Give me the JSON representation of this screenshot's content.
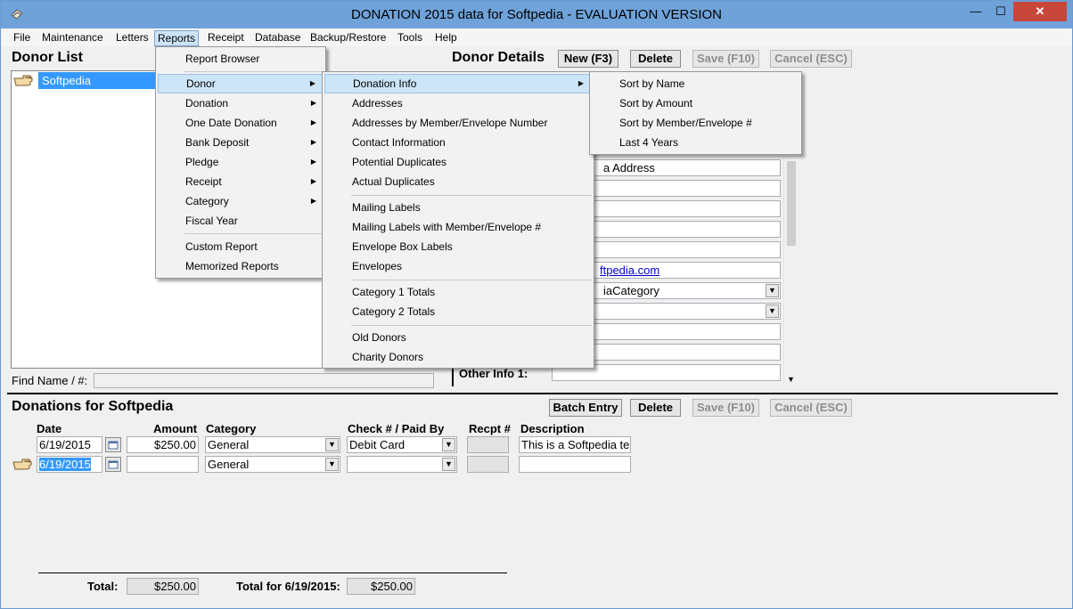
{
  "window": {
    "title": "DONATION 2015 data for Softpedia - EVALUATION VERSION",
    "min_glyph": "—",
    "max_glyph": "☐",
    "close_glyph": "✕",
    "icon": "app-icon"
  },
  "menubar": [
    "File",
    "Maintenance",
    "Letters",
    "Reports",
    "Receipt",
    "Database",
    "Backup/Restore",
    "Tools",
    "Help"
  ],
  "donor_list": {
    "title": "Donor List",
    "items": [
      "Softpedia"
    ],
    "find_label": "Find Name / #:",
    "find_value": ""
  },
  "donor_details": {
    "title": "Donor Details",
    "new_button": "New (F3)",
    "delete_button": "Delete",
    "save_button": "Save (F10)",
    "cancel_button": "Cancel (ESC)",
    "address_fragment": "a Address",
    "email_fragment": "ftpedia.com",
    "category_fragment": "iaCategory",
    "other_info_label": "Other Info 1:",
    "other_info_value": ""
  },
  "donations": {
    "title": "Donations for Softpedia",
    "batch_button": "Batch Entry",
    "delete_button": "Delete",
    "save_button": "Save (F10)",
    "cancel_button": "Cancel (ESC)",
    "columns": {
      "date": "Date",
      "amount": "Amount",
      "category": "Category",
      "check": "Check # / Paid By",
      "recpt": "Recpt #",
      "description": "Description"
    },
    "rows": [
      {
        "date": "6/19/2015",
        "amount": "$250.00",
        "category": "General",
        "check": "Debit Card",
        "recpt": "",
        "description": "This is a Softpedia te"
      },
      {
        "date": "6/19/2015",
        "amount": "",
        "category": "General",
        "check": "",
        "recpt": "",
        "description": ""
      }
    ],
    "total_label": "Total:",
    "total_value": "$250.00",
    "total_for_label": "Total for 6/19/2015:",
    "total_for_value": "$250.00"
  },
  "reports_menu": {
    "items": [
      "Report Browser",
      "Donor",
      "Donation",
      "One Date Donation",
      "Bank Deposit",
      "Pledge",
      "Receipt",
      "Category",
      "Fiscal Year",
      "Custom Report",
      "Memorized Reports"
    ],
    "submenu_arrow": "▶"
  },
  "donor_menu": {
    "items": [
      "Donation Info",
      "Addresses",
      "Addresses by Member/Envelope Number",
      "Contact Information",
      "Potential Duplicates",
      "Actual Duplicates",
      "Mailing Labels",
      "Mailing Labels with Member/Envelope #",
      "Envelope Box Labels",
      "Envelopes",
      "Category 1 Totals",
      "Category 2 Totals",
      "Old Donors",
      "Charity Donors"
    ]
  },
  "donation_info_menu": {
    "items": [
      "Sort by Name",
      "Sort by Amount",
      "Sort by Member/Envelope #",
      "Last 4 Years"
    ]
  },
  "colors": {
    "titlebar": "#6ea2d9",
    "selection": "#3399ff",
    "menu_highlight": "#cce4f7",
    "close_button": "#c7473a"
  }
}
